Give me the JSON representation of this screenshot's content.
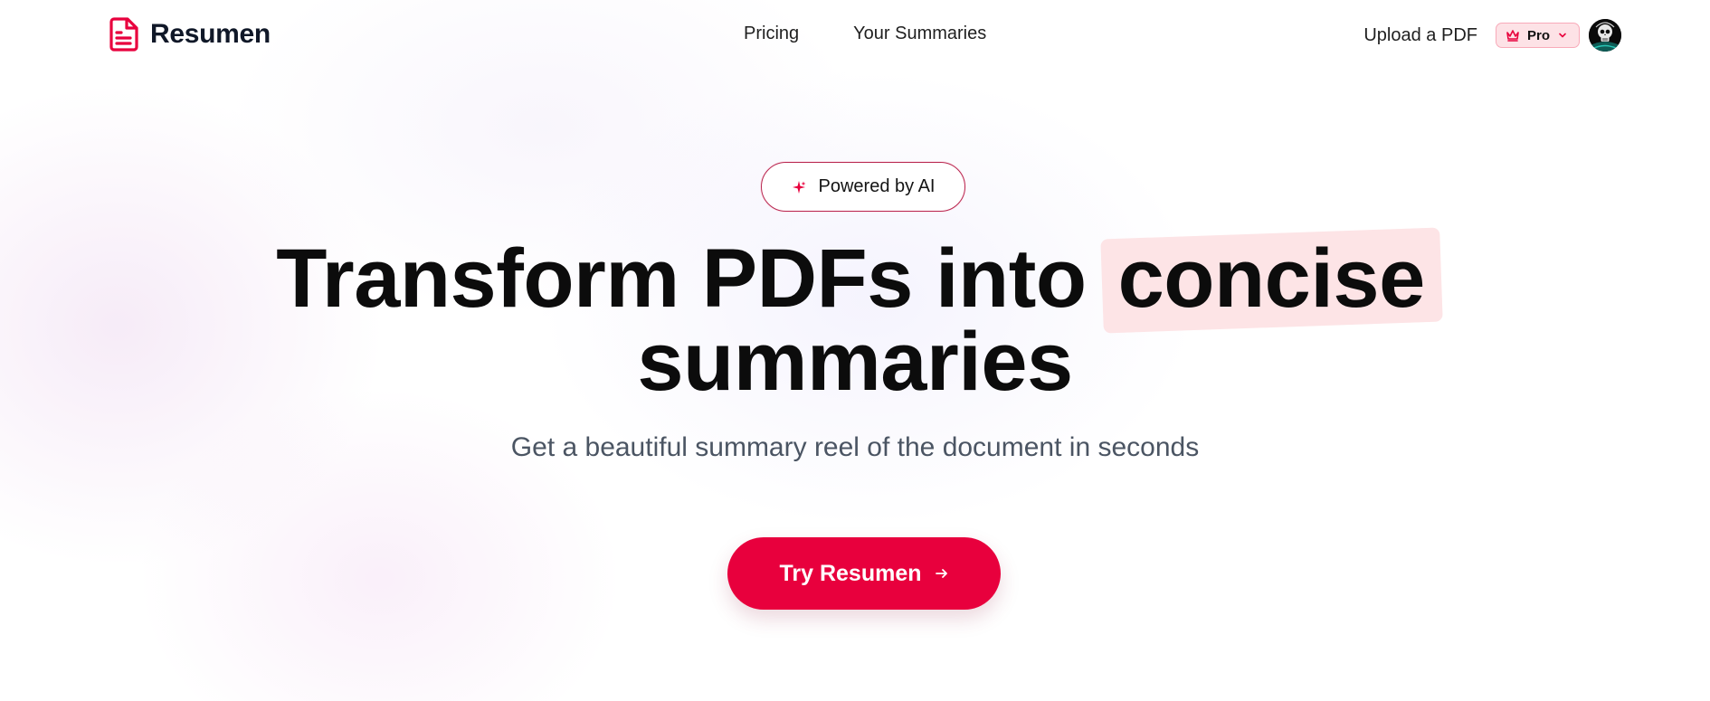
{
  "nav": {
    "brand": "Resumen",
    "links": [
      "Pricing",
      "Your Summaries"
    ],
    "upload_label": "Upload a PDF",
    "plan_badge": "Pro",
    "icons": {
      "brand": "file-text-icon",
      "plan": "crown-icon",
      "plan_toggle": "chevron-down-icon",
      "avatar": "skull-avatar"
    }
  },
  "hero": {
    "badge": "Powered by AI",
    "badge_icon": "sparkles-icon",
    "headline_start": "Transform PDFs into",
    "headline_highlight": "concise",
    "headline_end": "summaries",
    "subtitle": "Get a beautiful summary reel of the document in seconds",
    "cta_label": "Try Resumen",
    "cta_icon": "arrow-right-icon"
  },
  "colors": {
    "accent": "#e8003d",
    "highlight": "#fde4e6",
    "badge_border": "#b8264f",
    "text_muted": "#4b5563"
  }
}
